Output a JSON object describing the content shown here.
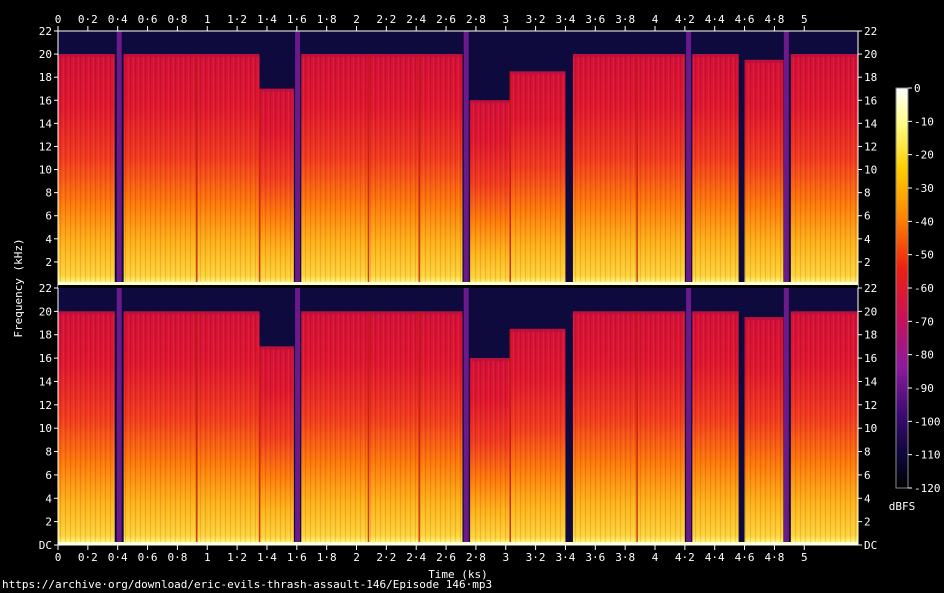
{
  "chart_data": {
    "type": "heatmap",
    "subtype": "spectrogram",
    "channels": 2,
    "xlabel": "Time (ks)",
    "ylabel": "Frequency (kHz)",
    "colorbar_label": "dBFS",
    "x_ticks": [
      "0",
      "0·2",
      "0·4",
      "0·6",
      "0·8",
      "1",
      "1·2",
      "1·4",
      "1·6",
      "1·8",
      "2",
      "2·2",
      "2·4",
      "2·6",
      "2·8",
      "3",
      "3·2",
      "3·4",
      "3·6",
      "3·8",
      "4",
      "4·2",
      "4·4",
      "4·6",
      "4·8",
      "5"
    ],
    "xlim": [
      0,
      5.36
    ],
    "y_ticks_top": [
      "22",
      "20",
      "18",
      "16",
      "14",
      "12",
      "10",
      "8",
      "6",
      "4",
      "2"
    ],
    "y_ticks_bottom": [
      "22",
      "20",
      "18",
      "16",
      "14",
      "12",
      "10",
      "8",
      "6",
      "4",
      "2",
      "DC"
    ],
    "ylim": [
      0,
      22
    ],
    "colorbar_ticks": [
      "0",
      "-10",
      "-20",
      "-30",
      "-40",
      "-50",
      "-60",
      "-70",
      "-80",
      "-90",
      "-100",
      "-110",
      "-120"
    ],
    "colorbar_range": [
      -120,
      0
    ],
    "segments": [
      {
        "start": 0.0,
        "end": 0.38,
        "cutoff": 20.0
      },
      {
        "start": 0.44,
        "end": 0.93,
        "cutoff": 20.0
      },
      {
        "start": 0.93,
        "end": 1.35,
        "cutoff": 20.0
      },
      {
        "start": 1.35,
        "end": 1.58,
        "cutoff": 17.0
      },
      {
        "start": 1.63,
        "end": 2.08,
        "cutoff": 20.0
      },
      {
        "start": 2.08,
        "end": 2.42,
        "cutoff": 20.0
      },
      {
        "start": 2.42,
        "end": 2.71,
        "cutoff": 20.0
      },
      {
        "start": 2.76,
        "end": 3.03,
        "cutoff": 16.0
      },
      {
        "start": 3.03,
        "end": 3.4,
        "cutoff": 18.5
      },
      {
        "start": 3.45,
        "end": 3.88,
        "cutoff": 20.0
      },
      {
        "start": 3.88,
        "end": 4.2,
        "cutoff": 20.0
      },
      {
        "start": 4.25,
        "end": 4.56,
        "cutoff": 20.0
      },
      {
        "start": 4.6,
        "end": 4.86,
        "cutoff": 19.5
      },
      {
        "start": 4.91,
        "end": 5.36,
        "cutoff": 20.0
      }
    ],
    "gaps": [
      0.41,
      1.605,
      2.735,
      4.225,
      4.88
    ]
  },
  "footer": {
    "source_url": "https://archive·org/download/eric-evils-thrash-assault-146/Episode 146·mp3"
  }
}
